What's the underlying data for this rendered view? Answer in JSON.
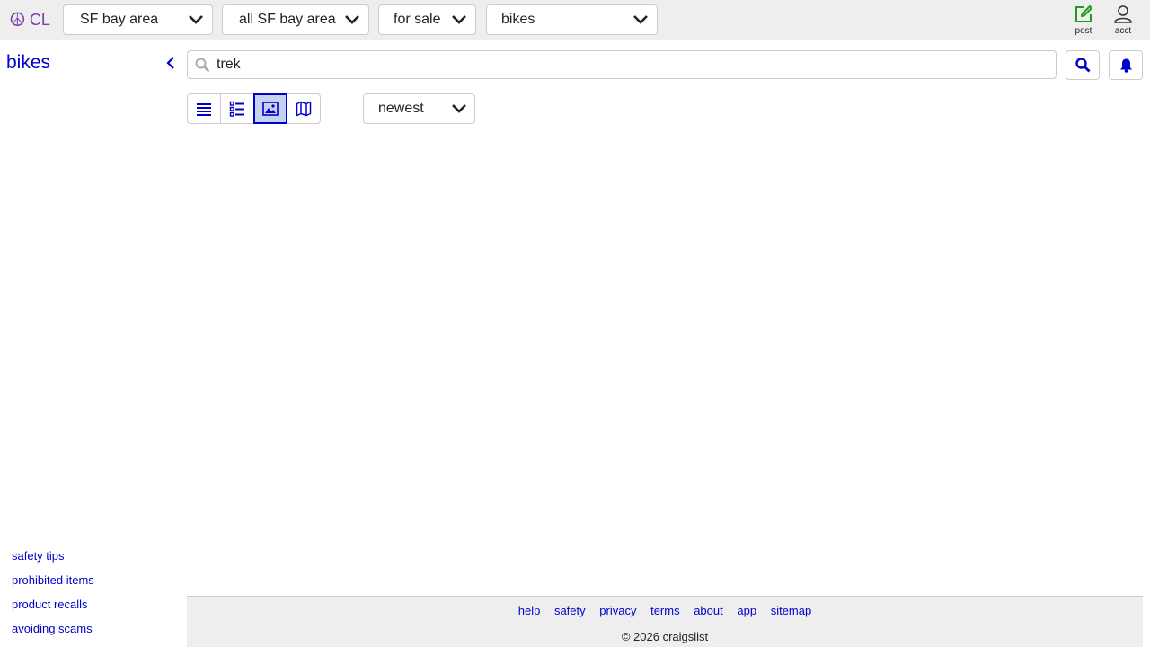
{
  "header": {
    "logo_text": "CL",
    "logo_symbol": "☮",
    "area_select": "SF bay area",
    "subarea_select": "all SF bay area",
    "section_select": "for sale",
    "category_select": "bikes",
    "post_label": "post",
    "account_label": "acct"
  },
  "left_panel": {
    "title": "bikes",
    "links": [
      "safety tips",
      "prohibited items",
      "product recalls",
      "avoiding scams"
    ]
  },
  "search": {
    "query": "trek",
    "search_icon": "magnifier-icon",
    "alert_icon": "bell-icon"
  },
  "view_modes": {
    "items": [
      "list",
      "thumb-list",
      "gallery",
      "map"
    ],
    "active": "gallery"
  },
  "sort": {
    "selected": "newest"
  },
  "footer": {
    "links": [
      "help",
      "safety",
      "privacy",
      "terms",
      "about",
      "app",
      "sitemap"
    ],
    "copyright": "© 2026 craigslist"
  },
  "colors": {
    "link": "#0000cc",
    "logo": "#7a3ea8",
    "post_icon": "#1aa01a",
    "header_bg": "#eeeeee",
    "active_view_bg": "#c5d3f0"
  }
}
